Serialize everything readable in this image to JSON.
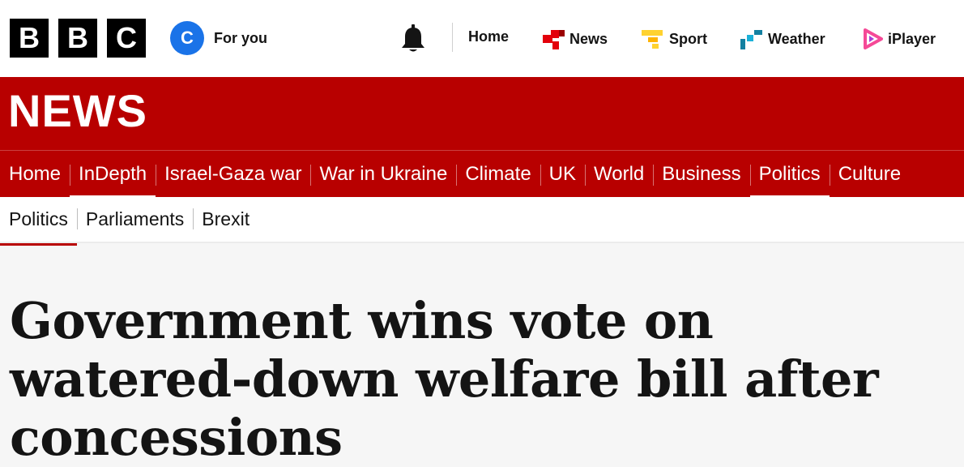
{
  "brand": {
    "logo_letters": [
      "B",
      "B",
      "C"
    ],
    "section_title": "NEWS",
    "accent_color": "#b80000"
  },
  "account": {
    "avatar_initial": "C",
    "label": "For you",
    "avatar_color": "#1a73e8"
  },
  "top_links": [
    {
      "label": "Home",
      "icon": "none"
    },
    {
      "label": "News",
      "icon": "news-icon",
      "color": "#e3000b"
    },
    {
      "label": "Sport",
      "icon": "sport-icon",
      "color": "#ffd230"
    },
    {
      "label": "Weather",
      "icon": "weather-icon",
      "color": "#1380a1"
    },
    {
      "label": "iPlayer",
      "icon": "iplayer-icon",
      "color": "#f54997"
    }
  ],
  "notifications_icon": "bell-icon",
  "primary_nav": {
    "items": [
      "Home",
      "InDepth",
      "Israel-Gaza war",
      "War in Ukraine",
      "Climate",
      "UK",
      "World",
      "Business",
      "Politics",
      "Culture"
    ]
  },
  "secondary_nav": {
    "items": [
      "Politics",
      "Parliaments",
      "Brexit"
    ]
  },
  "article": {
    "headline": "Government wins vote on watered-down welfare bill after concessions"
  }
}
